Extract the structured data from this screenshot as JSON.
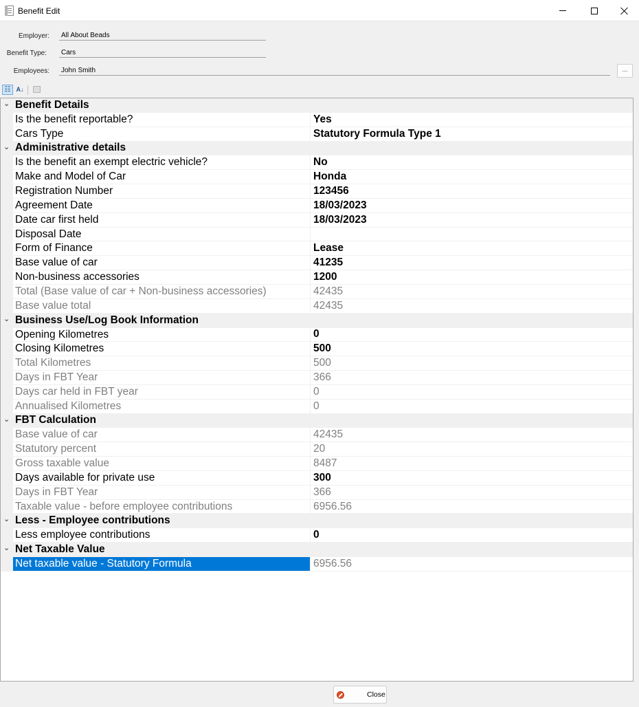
{
  "window": {
    "title": "Benefit Edit"
  },
  "header": {
    "employer_label": "Employer:",
    "employer_value": "All About Beads",
    "benefit_type_label": "Benefit Type:",
    "benefit_type_value": "Cars",
    "employees_label": "Employees:",
    "employees_value": "John  Smith",
    "browse_label": "..."
  },
  "toolbar": {
    "categorized_icon": "categorized-view-icon",
    "alphabetical_icon": "alphabetical-sort-icon",
    "alphabetical_label": "A↓",
    "property_pages_icon": "property-pages-icon"
  },
  "sections": [
    {
      "title": "Benefit Details",
      "rows": [
        {
          "name": "Is the benefit reportable?",
          "value": "Yes",
          "editable": true
        },
        {
          "name": "Cars Type",
          "value": "Statutory Formula Type 1",
          "editable": true
        }
      ]
    },
    {
      "title": "Administrative details",
      "rows": [
        {
          "name": "Is the benefit an exempt electric vehicle?",
          "value": "No",
          "editable": true
        },
        {
          "name": "Make and Model of Car",
          "value": "Honda",
          "editable": true
        },
        {
          "name": "Registration Number",
          "value": "123456",
          "editable": true
        },
        {
          "name": "Agreement Date",
          "value": "18/03/2023",
          "editable": true
        },
        {
          "name": "Date car first held",
          "value": "18/03/2023",
          "editable": true
        },
        {
          "name": "Disposal Date",
          "value": "",
          "editable": true
        },
        {
          "name": "Form of Finance",
          "value": "Lease",
          "editable": true
        },
        {
          "name": "Base value of car",
          "value": "41235",
          "editable": true
        },
        {
          "name": "Non-business accessories",
          "value": "1200",
          "editable": true
        },
        {
          "name": "Total (Base value of car + Non-business accessories)",
          "value": "42435",
          "editable": false
        },
        {
          "name": "Base value total",
          "value": "42435",
          "editable": false
        }
      ]
    },
    {
      "title": "Business Use/Log Book Information",
      "rows": [
        {
          "name": "Opening Kilometres",
          "value": "0",
          "editable": true
        },
        {
          "name": "Closing Kilometres",
          "value": "500",
          "editable": true
        },
        {
          "name": "Total Kilometres",
          "value": "500",
          "editable": false
        },
        {
          "name": "Days in FBT Year",
          "value": "366",
          "editable": false
        },
        {
          "name": "Days car held in FBT year",
          "value": "0",
          "editable": false
        },
        {
          "name": "Annualised Kilometres",
          "value": "0",
          "editable": false
        }
      ]
    },
    {
      "title": "FBT Calculation",
      "rows": [
        {
          "name": "Base value of car",
          "value": "42435",
          "editable": false
        },
        {
          "name": "Statutory percent",
          "value": "20",
          "editable": false
        },
        {
          "name": "Gross taxable value",
          "value": "8487",
          "editable": false
        },
        {
          "name": "Days available for private use",
          "value": "300",
          "editable": true
        },
        {
          "name": "Days in FBT Year",
          "value": "366",
          "editable": false
        },
        {
          "name": "Taxable value - before employee contributions",
          "value": "6956.56",
          "editable": false
        }
      ]
    },
    {
      "title": "Less - Employee contributions",
      "rows": [
        {
          "name": "Less employee contributions",
          "value": "0",
          "editable": true
        }
      ]
    },
    {
      "title": "Net Taxable Value",
      "rows": [
        {
          "name": "Net taxable value - Statutory Formula",
          "value": "6956.56",
          "editable": false,
          "selected": true
        }
      ]
    }
  ],
  "footer": {
    "close_label": "Close",
    "close_icon": "close-circle-icon"
  },
  "colors": {
    "selection": "#0078d7",
    "readonly_text": "#808080",
    "background": "#f0f0f0"
  }
}
